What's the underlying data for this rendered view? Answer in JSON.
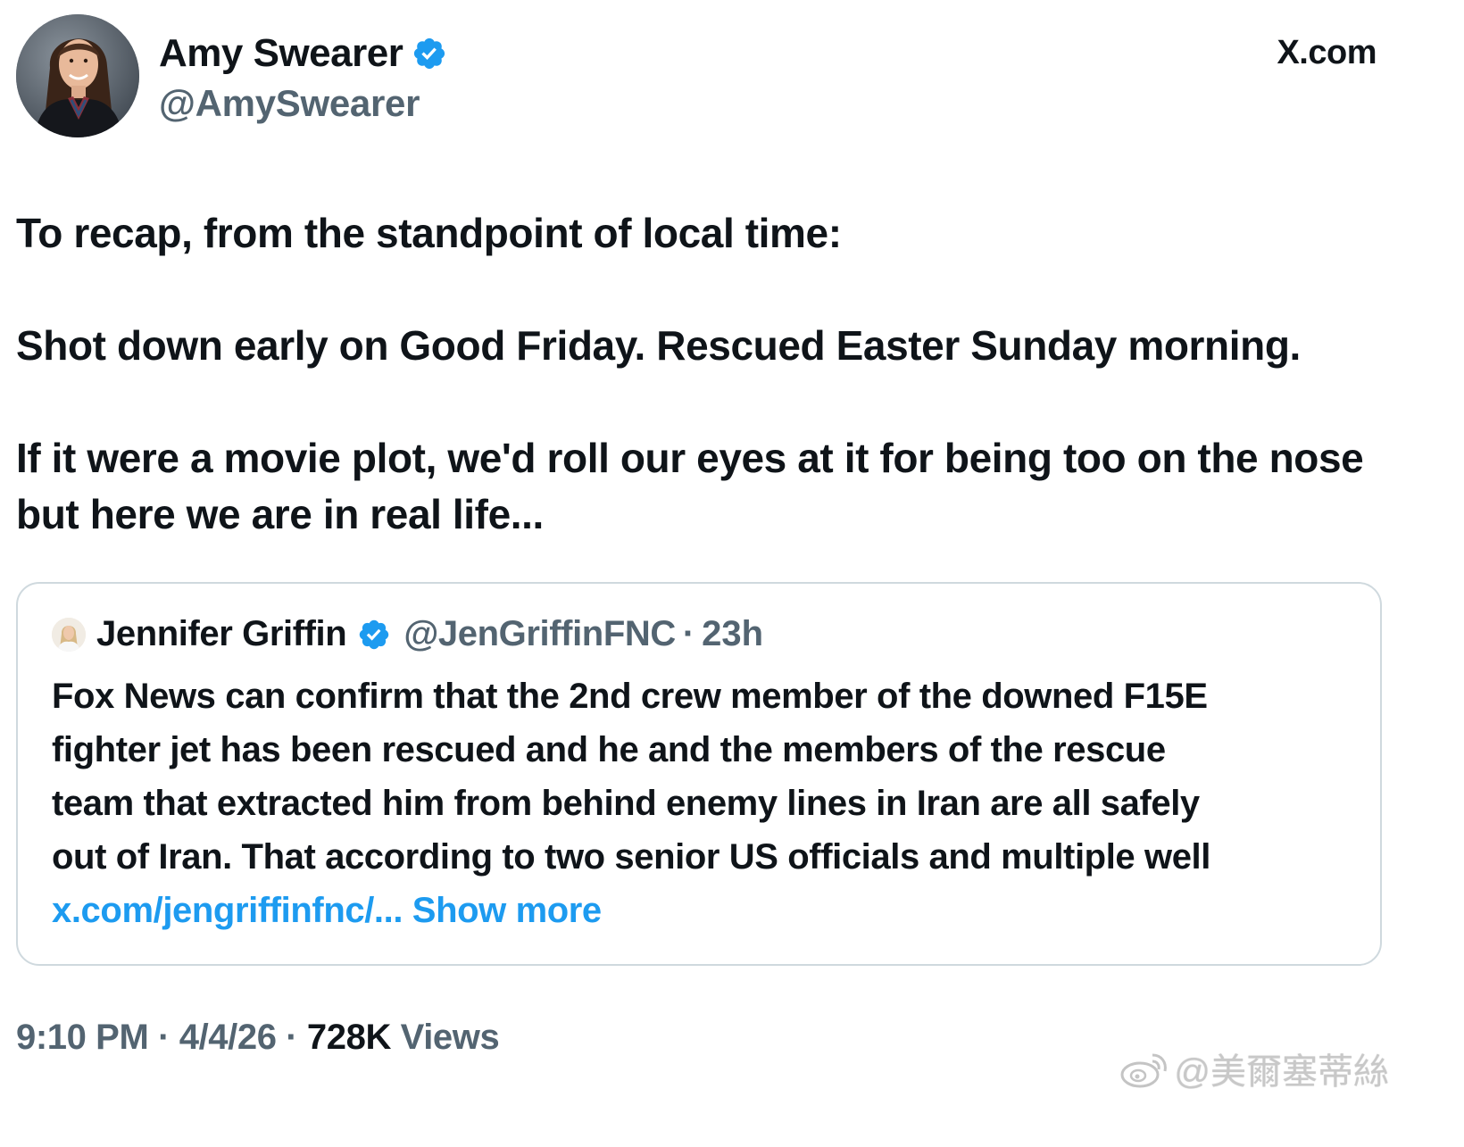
{
  "author": {
    "name": "Amy Swearer",
    "handle": "@AmySwearer",
    "verified_icon": "verified-badge-icon"
  },
  "site_label": "X.com",
  "tweet": {
    "paragraphs": [
      "To recap, from the standpoint of local time:",
      "Shot down early on Good Friday. Rescued Easter Sunday morning.",
      "If it were a movie plot, we'd roll our eyes at it for being too on the nose but here we are in real life..."
    ]
  },
  "quoted_tweet": {
    "name": "Jennifer Griffin",
    "handle": "@JenGriffinFNC",
    "separator": "·",
    "time": "23h",
    "lines": [
      "Fox News can confirm that the 2nd crew member of the downed F15E",
      "fighter jet has been rescued and he and the members of the rescue",
      "team that extracted him from behind enemy lines in Iran are all safely",
      "out of Iran. That according to two senior US officials and multiple well"
    ],
    "link": "x.com/jengriffinfnc/...",
    "show_more": "Show more"
  },
  "footer": {
    "time": "9:10 PM",
    "separator": "·",
    "date": "4/4/26",
    "views_count": "728K",
    "views_label": "Views"
  },
  "watermark": {
    "text": "@美爾塞蒂絲"
  },
  "colors": {
    "accent": "#1d9bf0",
    "text": "#0f1419",
    "muted": "#536471",
    "border": "#cfd9de"
  }
}
